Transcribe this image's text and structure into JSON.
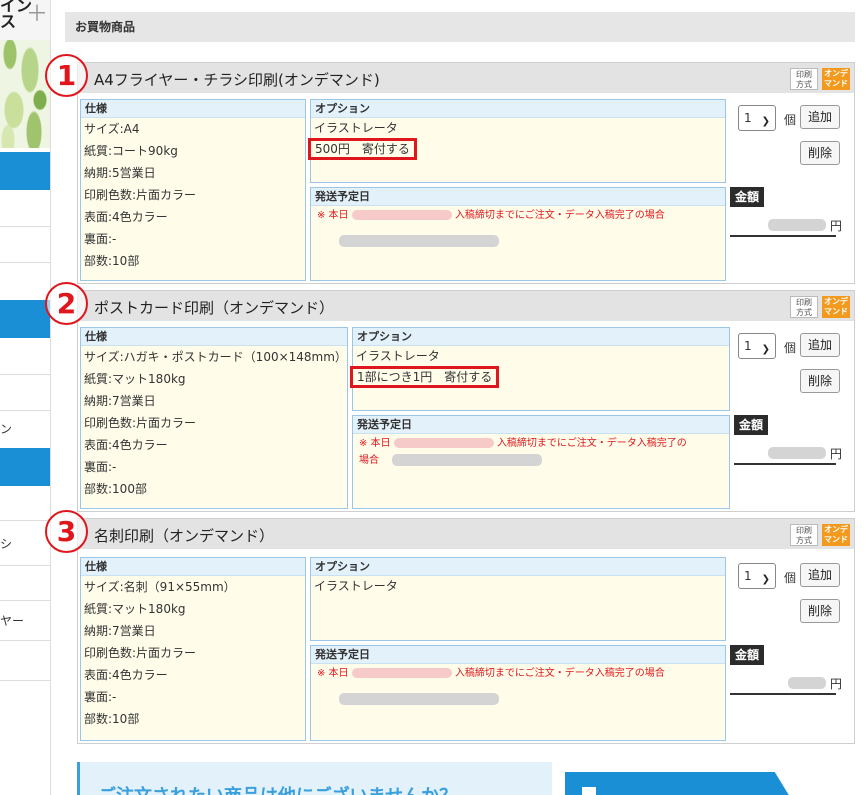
{
  "sidebar": {
    "logo_text": "イン\nス",
    "items": [
      "ン",
      "シ",
      "ヤー"
    ]
  },
  "section_title": "お買物商品",
  "products": [
    {
      "number": "1",
      "title": "A4フライヤー・チラシ印刷(オンデマンド)",
      "badge_print": "印刷\n方式",
      "badge_ondemand": "オンデ\nマンド",
      "spec_header": "仕様",
      "specs": [
        "サイズ:A4",
        "紙質:コート90kg",
        "納期:5営業日",
        "印刷色数:片面カラー",
        "表面:4色カラー",
        "裏面:-",
        "部数:10部"
      ],
      "option_header": "オプション",
      "option_software": "イラストレータ",
      "donation": "500円　寄付する",
      "ship_header": "発送予定日",
      "ship_prefix": "※ 本日",
      "ship_note": "入稿締切までにご注文・データ入稿完了の場合",
      "qty": "1",
      "unit": "個",
      "add_label": "追加",
      "delete_label": "削除",
      "amount_label": "金額",
      "yen": "円"
    },
    {
      "number": "2",
      "title": "ポストカード印刷（オンデマンド）",
      "badge_print": "印刷\n方式",
      "badge_ondemand": "オンデ\nマンド",
      "spec_header": "仕様",
      "specs": [
        "サイズ:ハガキ・ポストカード（100×148mm）",
        "紙質:マット180kg",
        "納期:7営業日",
        "印刷色数:片面カラー",
        "表面:4色カラー",
        "裏面:-",
        "部数:100部"
      ],
      "option_header": "オプション",
      "option_software": "イラストレータ",
      "donation": "1部につき1円　寄付する",
      "ship_header": "発送予定日",
      "ship_prefix": "※ 本日",
      "ship_note": "入稿締切までにご注文・データ入稿完了の",
      "ship_note2": "場合",
      "qty": "1",
      "unit": "個",
      "add_label": "追加",
      "delete_label": "削除",
      "amount_label": "金額",
      "yen": "円"
    },
    {
      "number": "3",
      "title": "名刺印刷（オンデマンド）",
      "badge_print": "印刷\n方式",
      "badge_ondemand": "オンデ\nマンド",
      "spec_header": "仕様",
      "specs": [
        "サイズ:名刺（91×55mm）",
        "紙質:マット180kg",
        "納期:7営業日",
        "印刷色数:片面カラー",
        "表面:4色カラー",
        "裏面:-",
        "部数:10部"
      ],
      "option_header": "オプション",
      "option_software": "イラストレータ",
      "ship_header": "発送予定日",
      "ship_prefix": "※ 本日",
      "ship_note": "入稿締切までにご注文・データ入稿完了の場合",
      "qty": "1",
      "unit": "個",
      "add_label": "追加",
      "delete_label": "削除",
      "amount_label": "金額",
      "yen": "円"
    }
  ],
  "banner_text": "ご注文されたい商品は他にございませんか？",
  "colors": {
    "accent_blue": "#1b8fd6",
    "highlight_red": "#e0161d",
    "ondemand_orange": "#f39a1e"
  }
}
